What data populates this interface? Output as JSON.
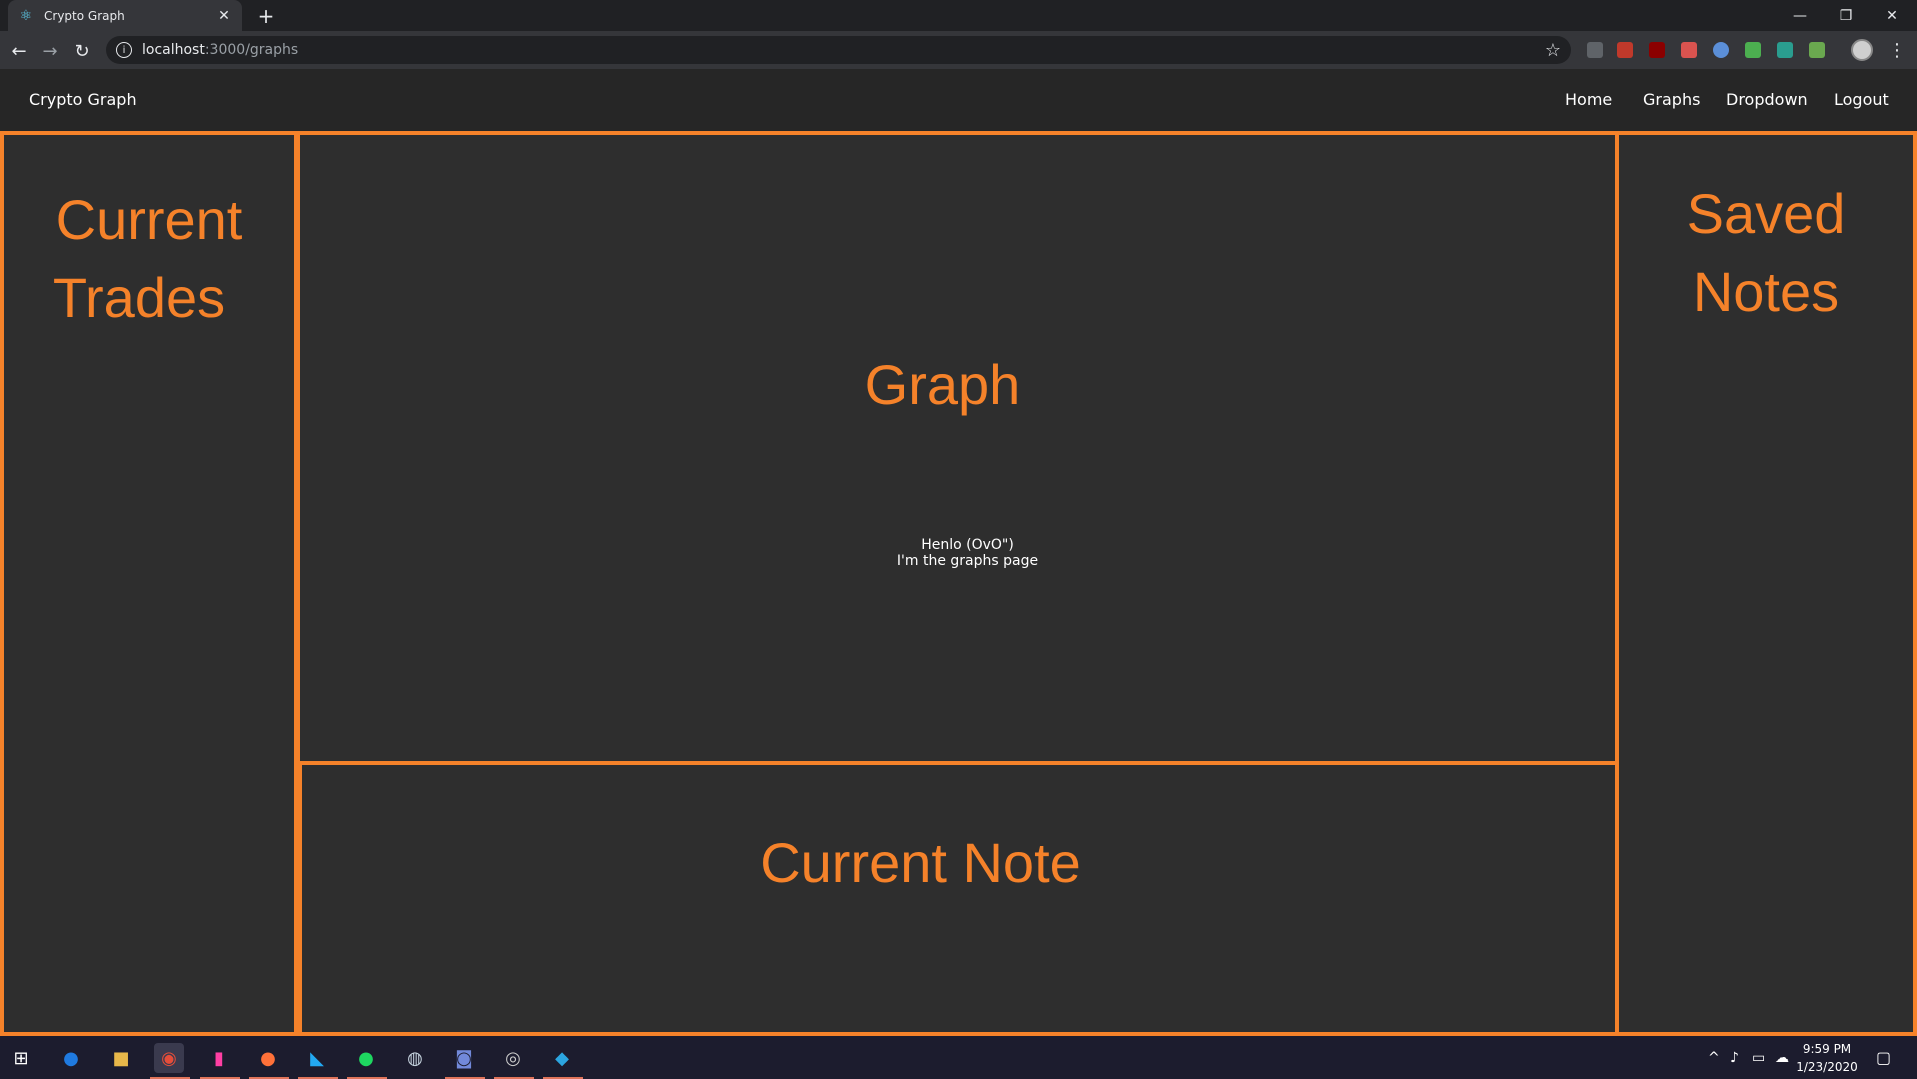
{
  "browser": {
    "tab_title": "Crypto Graph",
    "url_host": "localhost",
    "url_path": ":3000/graphs",
    "icons": {
      "favicon": "react-icon",
      "close": "close-icon",
      "new_tab": "plus-icon",
      "back": "arrow-left-icon",
      "forward": "arrow-right-icon",
      "reload": "reload-icon",
      "info": "info-icon",
      "star": "star-icon",
      "menu": "kebab-menu-icon"
    }
  },
  "app": {
    "brand": "Crypto Graph",
    "nav": {
      "home": "Home",
      "graphs": "Graphs",
      "dropdown": "Dropdown",
      "logout": "Logout"
    },
    "panels": {
      "current_trades": {
        "line1": "Current",
        "line2": "Trades"
      },
      "graph": {
        "title": "Graph",
        "line1": "Henlo (OvO\")",
        "line2": "I'm the graphs page"
      },
      "current_note": {
        "title": "Current Note"
      },
      "saved_notes": {
        "line1": "Saved",
        "line2": "Notes"
      }
    },
    "colors": {
      "accent": "#f5822a",
      "background": "#2f2f2f",
      "navbar": "#262626"
    }
  },
  "taskbar": {
    "clock_time": "9:59 PM",
    "clock_date": "1/23/2020",
    "apps": [
      "windows-start-icon",
      "firefox-dev-icon",
      "file-explorer-icon",
      "chrome-icon",
      "terminal-icon",
      "firefox-icon",
      "vscode-icon",
      "spotify-icon",
      "steam-icon",
      "discord-icon",
      "obs-icon",
      "telegram-icon"
    ]
  }
}
